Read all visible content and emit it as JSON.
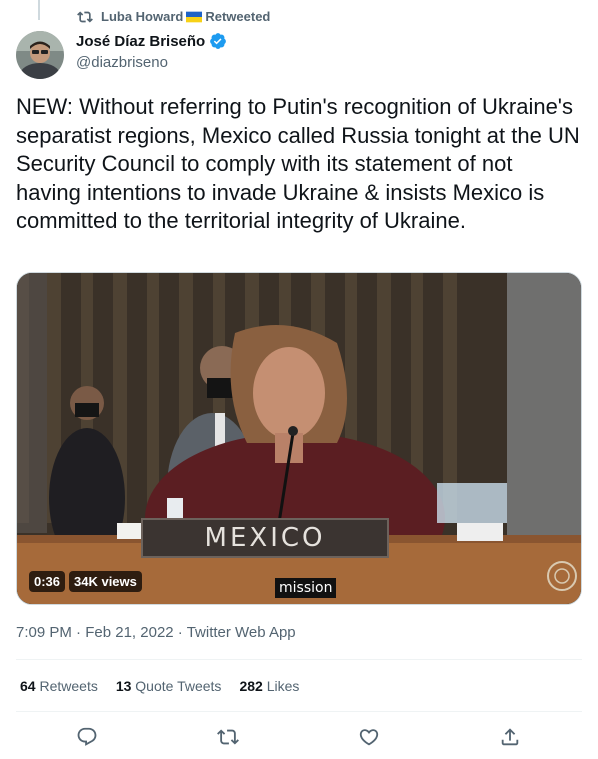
{
  "retweet_bar": {
    "retweeter": "Luba Howard",
    "suffix": "Retweeted",
    "icon": "retweet-icon",
    "flag": "ukraine-flag-emoji"
  },
  "author": {
    "name": "José Díaz Briseño",
    "handle": "@diazbriseno",
    "verified": true
  },
  "tweet": {
    "text": "NEW: Without referring to Putin's recognition of Ukraine's separatist regions, Mexico called Russia tonight at the UN Security Council to comply with its statement of not having intentions to invade Ukraine & insists Mexico is committed to the territorial integrity of Ukraine."
  },
  "media": {
    "duration": "0:36",
    "views": "34K views",
    "caption": "mission",
    "placard": "MEXICO"
  },
  "meta": {
    "time": "7:09 PM",
    "date": "Feb 21, 2022",
    "source": "Twitter Web App",
    "separator": "·"
  },
  "stats": {
    "retweets_count": "64",
    "retweets_label": "Retweets",
    "quotes_count": "13",
    "quotes_label": "Quote Tweets",
    "likes_count": "282",
    "likes_label": "Likes"
  },
  "actions": [
    "reply-icon",
    "retweet-icon",
    "like-icon",
    "share-icon"
  ],
  "colors": {
    "text": "#0f1419",
    "secondary": "#536471",
    "verified": "#1d9bf0",
    "divider": "#eff3f4"
  }
}
